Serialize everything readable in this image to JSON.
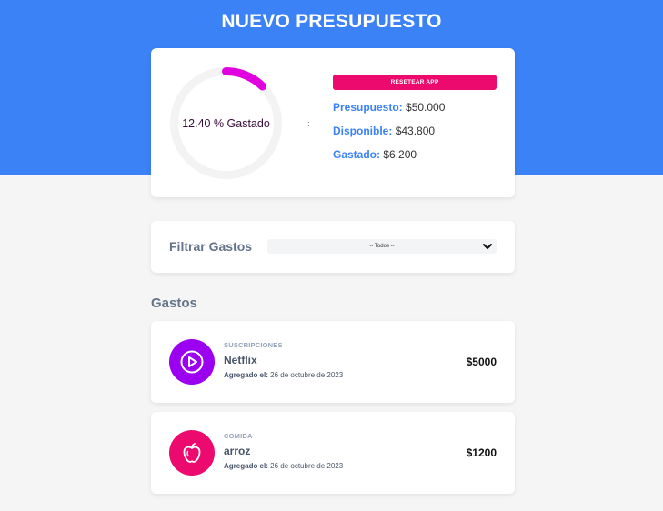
{
  "header": {
    "title": "NUEVO PRESUPUESTO"
  },
  "budget": {
    "percent_spent": 12.4,
    "percent_text": "12.40 % Gastado",
    "separator": ":",
    "reset_label": "RESETEAR APP",
    "presupuesto_label": "Presupuesto:",
    "presupuesto_value": "$50.000",
    "disponible_label": "Disponible:",
    "disponible_value": "$43.800",
    "gastado_label": "Gastado:",
    "gastado_value": "$6.200"
  },
  "filter": {
    "label": "Filtrar Gastos",
    "selected": "-- Todos --"
  },
  "expenses": {
    "title": "Gastos",
    "items": [
      {
        "category": "SUSCRIPCIONES",
        "name": "Netflix",
        "date_label": "Agregado el:",
        "date": "26 de octubre de 2023",
        "amount": "$5000",
        "icon": "play-icon",
        "color": "#9b00f0"
      },
      {
        "category": "COMIDA",
        "name": "arroz",
        "date_label": "Agregado el:",
        "date": "26 de octubre de 2023",
        "amount": "$1200",
        "icon": "apple-icon",
        "color": "#ec0a6f"
      }
    ]
  },
  "colors": {
    "primary": "#3b82f6",
    "accent": "#ec0a6f",
    "ring": "#e000e0"
  }
}
